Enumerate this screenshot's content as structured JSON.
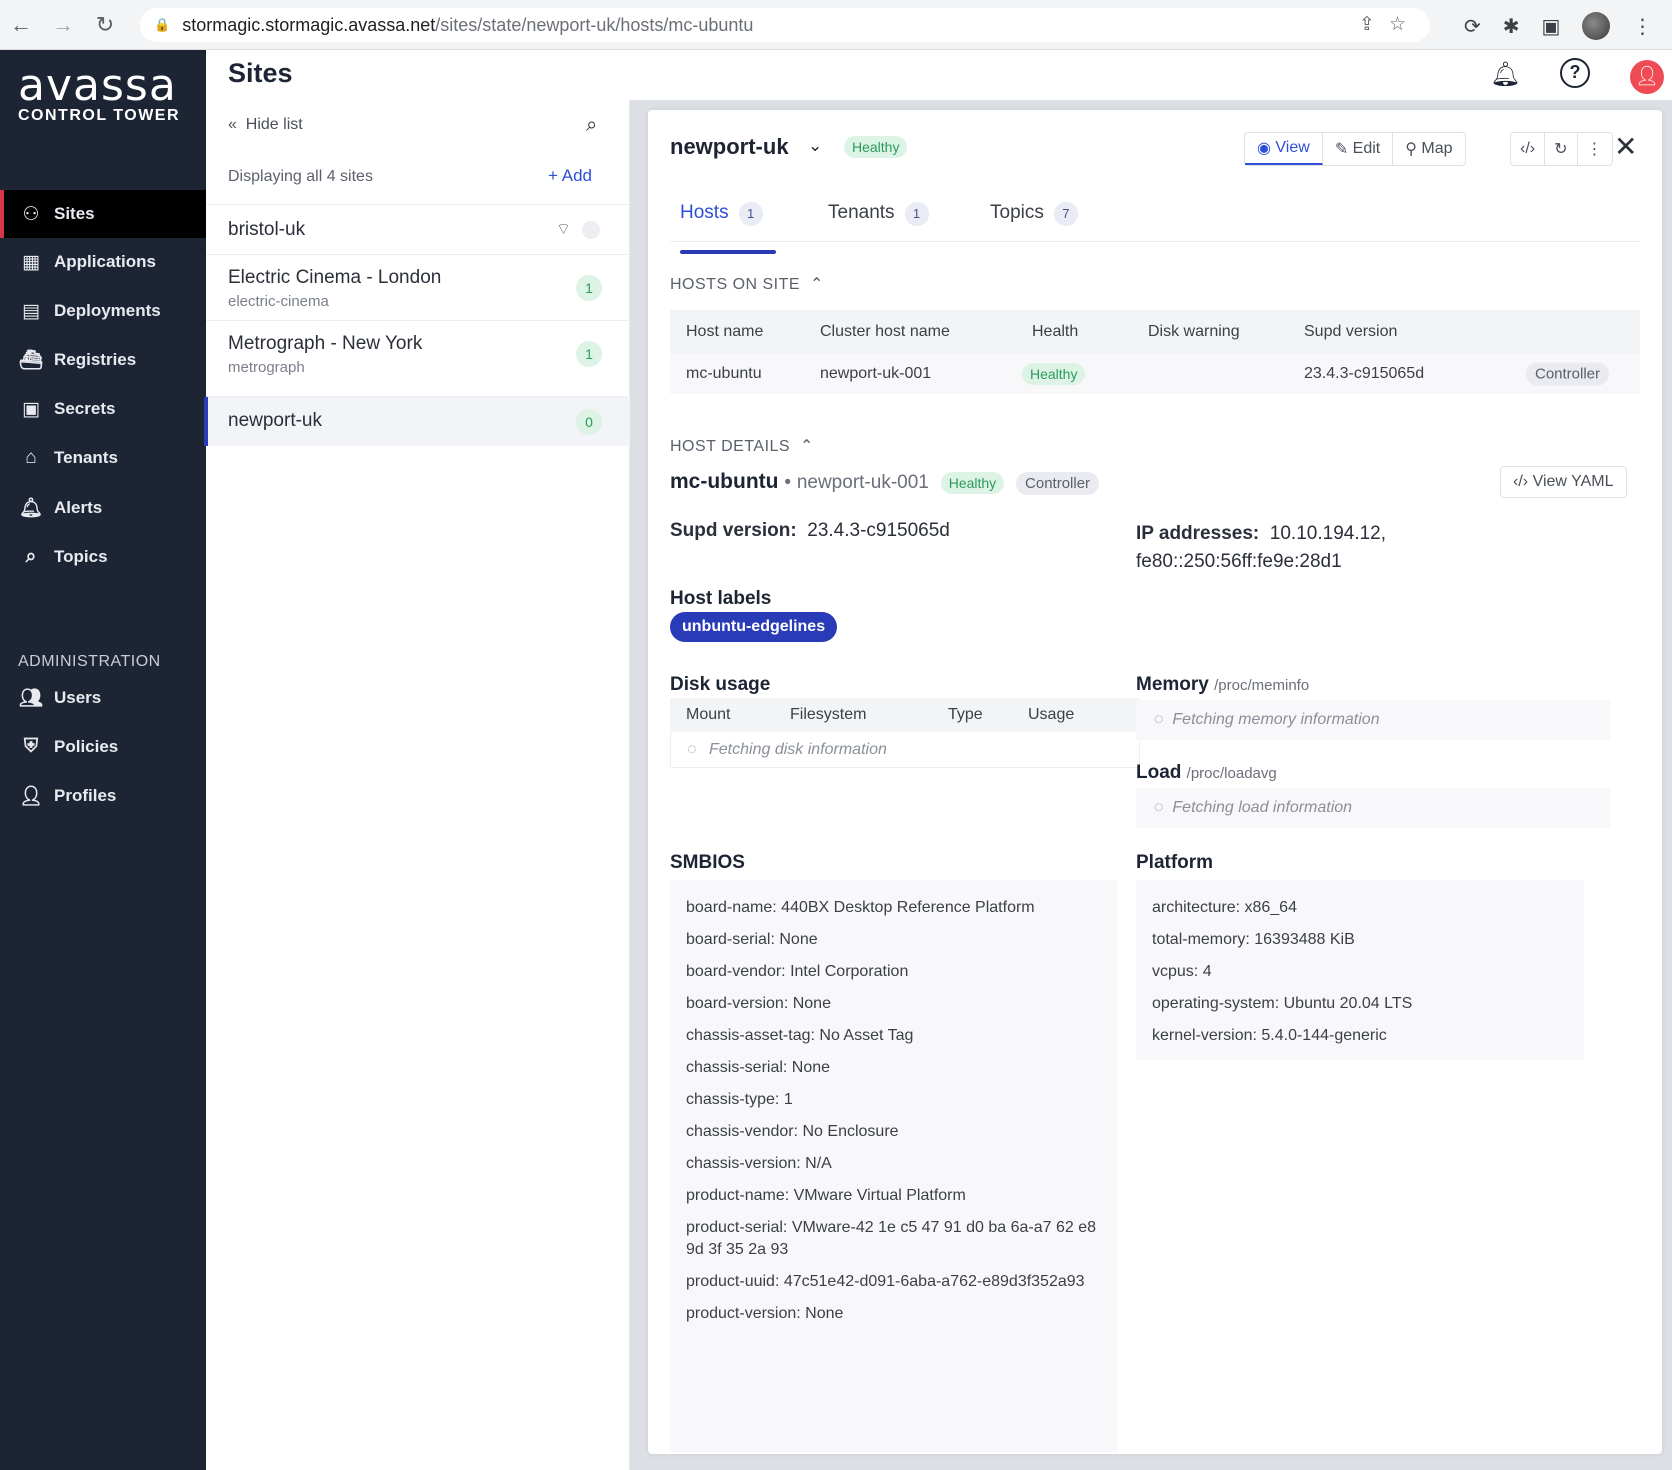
{
  "browser": {
    "url_host": "stormagic.stormagic.avassa.net",
    "url_path": "/sites/state/newport-uk/hosts/mc-ubuntu"
  },
  "sidebar": {
    "logo": "avassa",
    "logo_sub": "CONTROL TOWER",
    "items": [
      {
        "label": "Sites",
        "icon": "sites-icon"
      },
      {
        "label": "Applications",
        "icon": "applications-icon"
      },
      {
        "label": "Deployments",
        "icon": "deployments-icon"
      },
      {
        "label": "Registries",
        "icon": "registries-icon"
      },
      {
        "label": "Secrets",
        "icon": "secrets-icon"
      },
      {
        "label": "Tenants",
        "icon": "tenants-icon"
      },
      {
        "label": "Alerts",
        "icon": "bell-icon"
      },
      {
        "label": "Topics",
        "icon": "search-icon"
      }
    ],
    "admin_label": "ADMINISTRATION",
    "admin_items": [
      {
        "label": "Users",
        "icon": "users-icon"
      },
      {
        "label": "Policies",
        "icon": "shield-icon"
      },
      {
        "label": "Profiles",
        "icon": "profiles-icon"
      }
    ]
  },
  "header": {
    "title": "Sites"
  },
  "list": {
    "hide_list": "Hide list",
    "displaying": "Displaying all 4 sites",
    "add": "Add",
    "sites": [
      {
        "name": "bristol-uk",
        "sub": "",
        "count": ""
      },
      {
        "name": "Electric Cinema - London",
        "sub": "electric-cinema",
        "count": "1"
      },
      {
        "name": "Metrograph - New York",
        "sub": "metrograph",
        "count": "1"
      },
      {
        "name": "newport-uk",
        "sub": "",
        "count": "0"
      }
    ]
  },
  "detail": {
    "site": "newport-uk",
    "health": "Healthy",
    "toolbar": {
      "view": "View",
      "edit": "Edit",
      "map": "Map"
    },
    "tabs": [
      {
        "label": "Hosts",
        "count": "1"
      },
      {
        "label": "Tenants",
        "count": "1"
      },
      {
        "label": "Topics",
        "count": "7"
      }
    ],
    "hosts_on_site": "HOSTS ON SITE",
    "hosts_table": {
      "headers": [
        "Host name",
        "Cluster host name",
        "Health",
        "Disk warning",
        "Supd version"
      ],
      "row": {
        "host": "mc-ubuntu",
        "cluster": "newport-uk-001",
        "health": "Healthy",
        "disk": "",
        "supd": "23.4.3-c915065d",
        "role": "Controller"
      }
    },
    "host_details_label": "HOST DETAILS",
    "host_details": {
      "name": "mc-ubuntu",
      "separator": "•",
      "cluster": "newport-uk-001",
      "health": "Healthy",
      "role": "Controller",
      "view_yaml": "View YAML",
      "supd_label": "Supd version:",
      "supd_value": "23.4.3-c915065d",
      "ip_label": "IP addresses:",
      "ip_value_1": "10.10.194.12,",
      "ip_value_2": "fe80::250:56ff:fe9e:28d1",
      "host_labels_title": "Host labels",
      "host_label": "unbuntu-edgelines"
    },
    "disk": {
      "title": "Disk usage",
      "headers": [
        "Mount",
        "Filesystem",
        "Type",
        "Usage"
      ],
      "fetching": "Fetching disk information"
    },
    "memory": {
      "title": "Memory",
      "path": "/proc/meminfo",
      "fetching": "Fetching memory information"
    },
    "load": {
      "title": "Load",
      "path": "/proc/loadavg",
      "fetching": "Fetching load information"
    },
    "smbios": {
      "title": "SMBIOS",
      "items": [
        "board-name: 440BX Desktop Reference Platform",
        "board-serial: None",
        "board-vendor: Intel Corporation",
        "board-version: None",
        "chassis-asset-tag: No Asset Tag",
        "chassis-serial: None",
        "chassis-type: 1",
        "chassis-vendor: No Enclosure",
        "chassis-version: N/A",
        "product-name: VMware Virtual Platform",
        "product-serial: VMware-42 1e c5 47 91 d0 ba 6a-a7 62 e8 9d 3f 35 2a 93",
        "product-uuid: 47c51e42-d091-6aba-a762-e89d3f352a93",
        "product-version: None"
      ]
    },
    "platform": {
      "title": "Platform",
      "items": [
        "architecture: x86_64",
        "total-memory: 16393488 KiB",
        "vcpus: 4",
        "operating-system: Ubuntu 20.04 LTS",
        "kernel-version: 5.4.0-144-generic"
      ]
    }
  }
}
